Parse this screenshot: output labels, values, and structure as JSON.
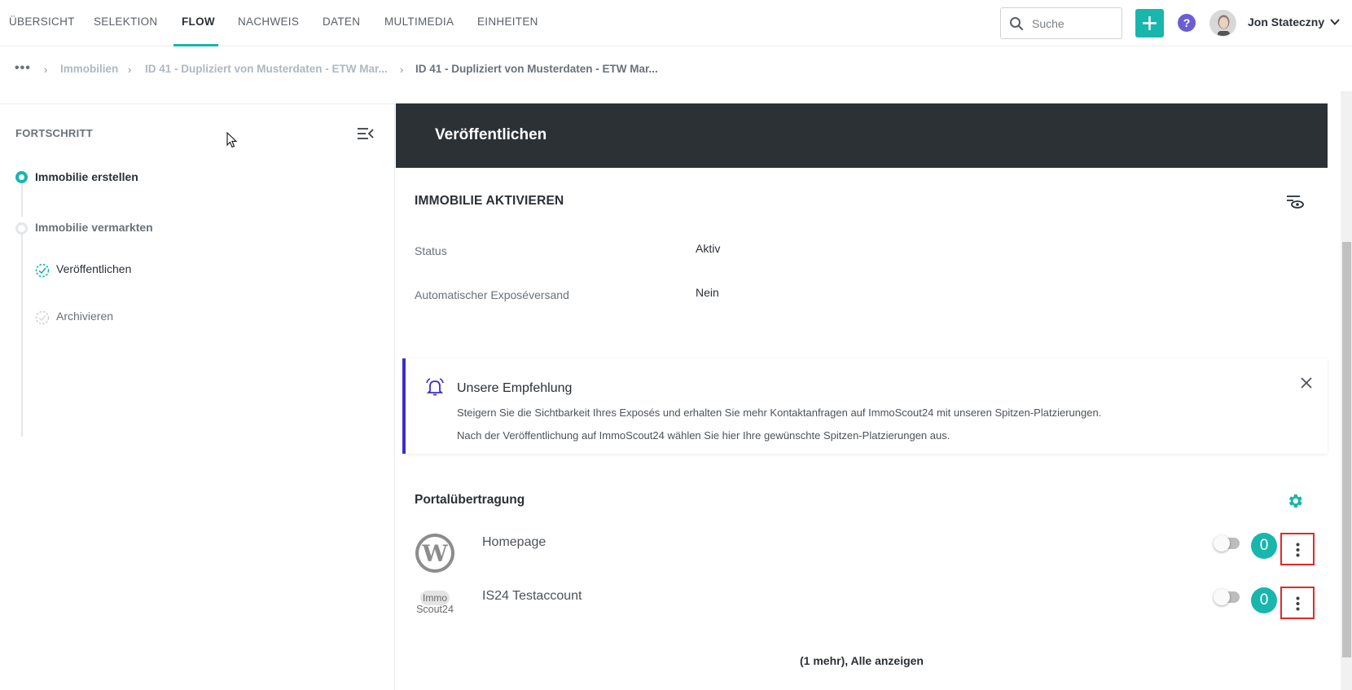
{
  "nav": {
    "tabs": [
      "ÜBERSICHT",
      "SELEKTION",
      "FLOW",
      "NACHWEIS",
      "DATEN",
      "MULTIMEDIA",
      "EINHEITEN"
    ],
    "active_tab": "FLOW",
    "search_placeholder": "Suche",
    "user_name": "Jon Stateczny"
  },
  "breadcrumb": {
    "items": [
      "Immobilien",
      "ID 41 - Dupliziert von Musterdaten - ETW Mar...",
      "ID 41 - Dupliziert von Musterdaten - ETW Mar..."
    ]
  },
  "sidebar": {
    "title": "FORTSCHRITT",
    "steps": [
      {
        "label": "Immobilie erstellen",
        "state": "active"
      },
      {
        "label": "Immobilie vermarkten",
        "state": "inactive"
      }
    ],
    "substeps": [
      {
        "label": "Veröffentlichen",
        "state": "current"
      },
      {
        "label": "Archivieren",
        "state": "pending"
      }
    ]
  },
  "main": {
    "header_title": "Veröffentlichen",
    "section_title": "IMMOBILIE AKTIVIEREN",
    "fields": [
      {
        "label": "Status",
        "value": "Aktiv"
      },
      {
        "label": "Automatischer Exposéversand",
        "value": "Nein"
      }
    ],
    "recommendation": {
      "title": "Unsere Empfehlung",
      "line1": "Steigern Sie die Sichtbarkeit Ihres Exposés und erhalten Sie mehr Kontaktanfragen auf ImmoScout24 mit unseren Spitzen-Platzierungen.",
      "line2": "Nach der Veröffentlichung auf ImmoScout24 wählen Sie hier Ihre gewünschte Spitzen-Platzierungen aus."
    },
    "portal_title": "Portalübertragung",
    "portals": [
      {
        "name": "Homepage",
        "logo": "wordpress-logo",
        "enabled": false,
        "count": "0"
      },
      {
        "name": "IS24 Testaccount",
        "logo": "immoscout24-logo",
        "logo_text_1": "Immo",
        "logo_text_2": "Scout24",
        "enabled": false,
        "count": "0"
      }
    ],
    "show_all": "(1 mehr), Alle anzeigen"
  },
  "colors": {
    "accent": "#18b6ac",
    "header_bg": "#2c3136",
    "recommendation_border": "#3b2fc9",
    "highlight_border": "#e0292b",
    "help": "#6c5dd3"
  }
}
